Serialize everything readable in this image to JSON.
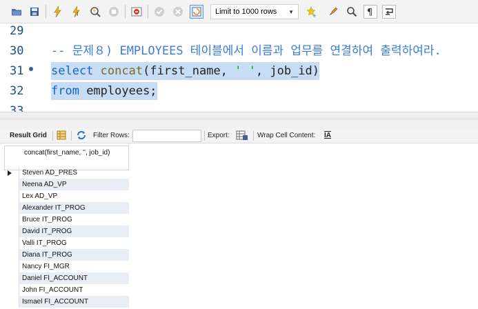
{
  "toolbar": {
    "limit_label": "Limit to 1000 rows",
    "buttons": [
      "open-folder-icon",
      "save-icon",
      "execute-icon",
      "execute-current-icon",
      "explain-icon",
      "stop-icon",
      "toggle-error-icon",
      "commit-icon",
      "rollback-icon",
      "autocommit-icon",
      "beautify-icon",
      "find-icon",
      "invisible-chars-icon",
      "wrap-icon"
    ]
  },
  "editor": {
    "lines": [
      {
        "number": "29",
        "text": ""
      },
      {
        "number": "30",
        "text": "-- 문제８) EMPLOYEES 테이블에서 이름과 업무를 연결하여 출력하여라."
      },
      {
        "number": "31",
        "kw": "select",
        "fn": "concat",
        "pre": "(first_name, ",
        "str": "' '",
        "post": ", job_id)"
      },
      {
        "number": "32",
        "kw": "from",
        "post": " employees;"
      },
      {
        "number": "33",
        "text": ""
      }
    ]
  },
  "result_toolbar": {
    "result_grid": "Result Grid",
    "filter_rows": "Filter Rows:",
    "export": "Export:",
    "wrap_cell": "Wrap Cell Content:",
    "wrap_icon_glyph": "IA"
  },
  "grid": {
    "column_header": "concat(first_name, '', job_id)",
    "rows": [
      "Steven AD_PRES",
      "Neena AD_VP",
      "Lex AD_VP",
      "Alexander IT_PROG",
      "Bruce IT_PROG",
      "David IT_PROG",
      "Valli IT_PROG",
      "Diana IT_PROG",
      "Nancy FI_MGR",
      "Daniel FI_ACCOUNT",
      "John FI_ACCOUNT",
      "Ismael FI_ACCOUNT"
    ]
  },
  "colors": {
    "selection": "#c7dcf5",
    "keyword": "#1565c8",
    "string": "#1f9a1f",
    "alt_row": "#e9eef6"
  }
}
